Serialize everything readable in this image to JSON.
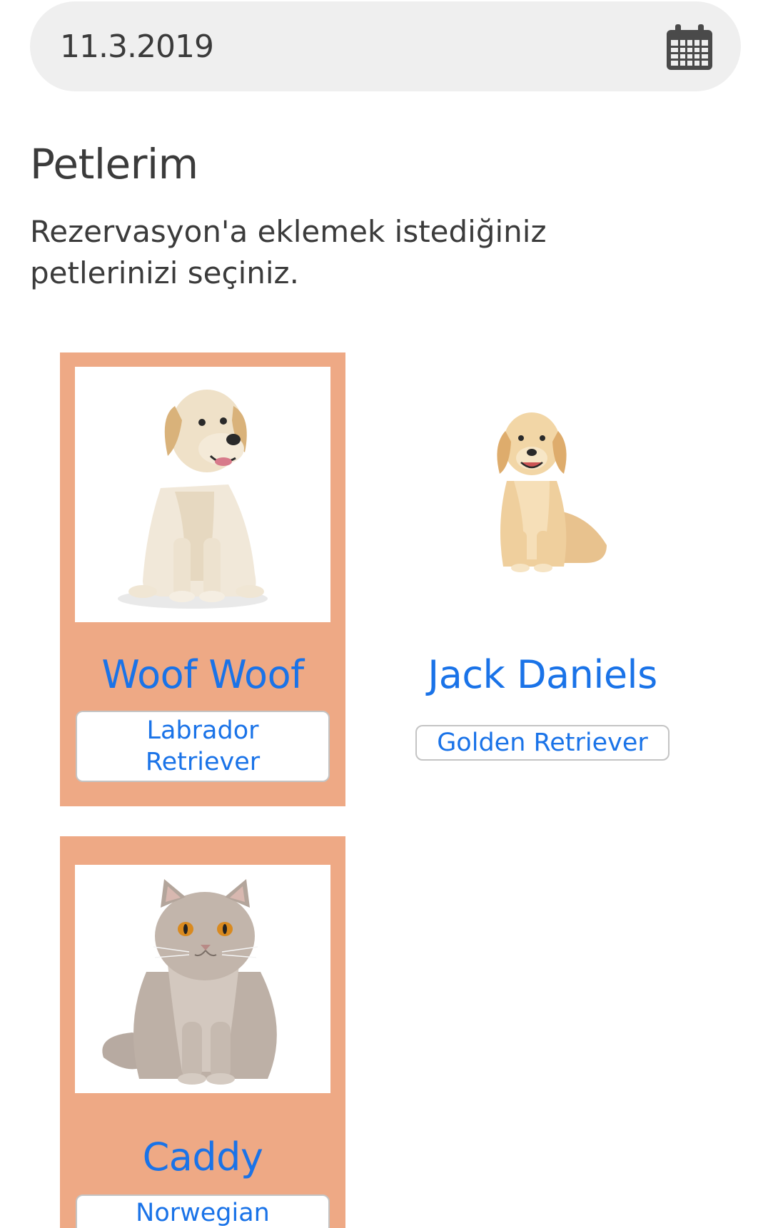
{
  "date_field": {
    "value": "11.3.2019",
    "icon": "calendar-icon"
  },
  "section": {
    "title": "Petlerim",
    "description": "Rezervasyon'a eklemek istediğiniz petlerinizi seçiniz."
  },
  "colors": {
    "selected_card": "#eea985",
    "accent": "#1a73e8",
    "date_field_bg": "#efefef"
  },
  "pets": [
    {
      "name": "Woof Woof",
      "breed": "Labrador Retriever",
      "species": "dog",
      "selected": true
    },
    {
      "name": "Jack Daniels",
      "breed": "Golden Retriever",
      "species": "dog",
      "selected": false
    },
    {
      "name": "Caddy",
      "breed": "Norwegian",
      "species": "cat",
      "selected": true
    }
  ]
}
